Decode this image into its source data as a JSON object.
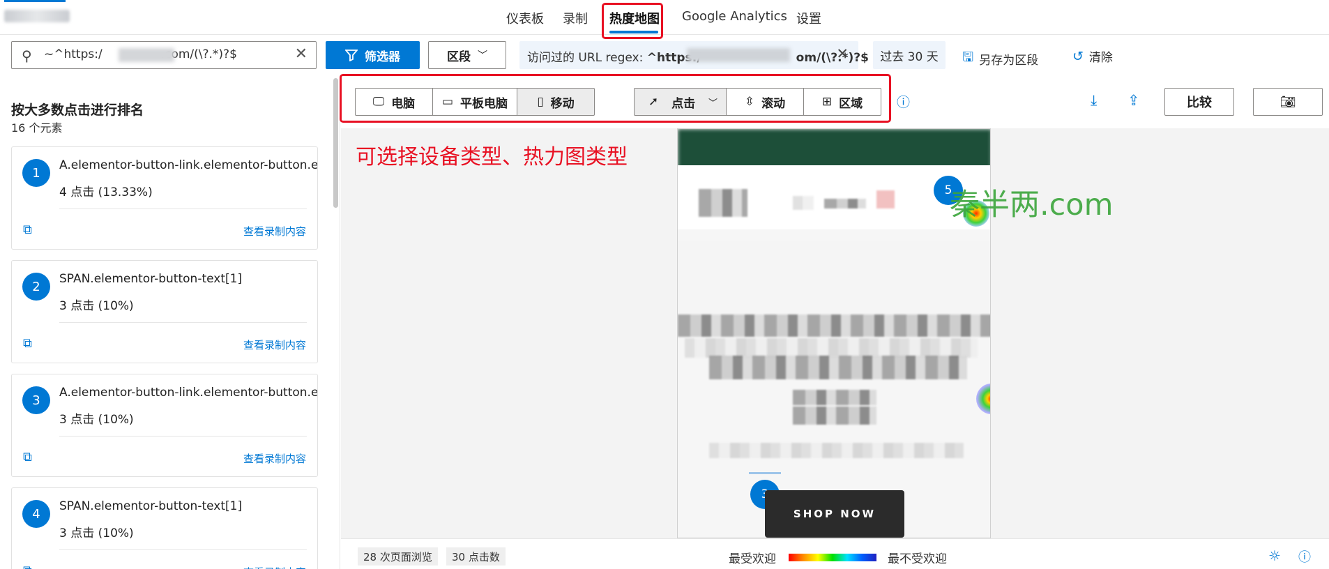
{
  "nav": {
    "tabs": [
      "仪表板",
      "录制",
      "热度地图",
      "Google Analytics",
      "设置"
    ],
    "active": "热度地图"
  },
  "filterbar": {
    "search_value": "~^https:/              .com/(\\?.*)?$",
    "search_prefix": "~^https:/",
    "search_suffix": ".com/(\\?.*)?$",
    "filter_label": "筛选器",
    "segment_label": "区段",
    "url_chip_prefix": "访问过的 URL regex: ",
    "url_chip_bold_a": "^https:/",
    "url_chip_bold_b": "om/(\\?.*)?$",
    "date_chip": "过去 30 天",
    "save_segment": "另存为区段",
    "clear": "清除"
  },
  "left_panel": {
    "title": "按大多数点击进行排名",
    "subtitle": "16 个元素",
    "view_label": "查看录制内容",
    "items": [
      {
        "rank": "1",
        "selector": "A.elementor-button-link.elementor-button.ele",
        "clicks": "4 点击 (13.33%)"
      },
      {
        "rank": "2",
        "selector": "SPAN.elementor-button-text[1]",
        "clicks": "3 点击 (10%)"
      },
      {
        "rank": "3",
        "selector": "A.elementor-button-link.elementor-button.ele",
        "clicks": "3 点击 (10%)"
      },
      {
        "rank": "4",
        "selector": "SPAN.elementor-button-text[1]",
        "clicks": "3 点击 (10%)"
      }
    ]
  },
  "toolbar": {
    "devices": [
      "电脑",
      "平板电脑",
      "移动"
    ],
    "selected_device": "移动",
    "heatmap_types": [
      "点击",
      "滚动",
      "区域"
    ],
    "compare": "比较"
  },
  "annotation": "可选择设备类型、热力图类型",
  "watermark": "秦半两.com",
  "preview": {
    "badge_top": "5",
    "badge_bottom": "3",
    "button_text": "SHOP NOW"
  },
  "bottombar": {
    "page_views": "28 次页面浏览",
    "clicks": "30 点击数",
    "legend_most": "最受欢迎",
    "legend_least": "最不受欢迎"
  },
  "colors": {
    "accent": "#0078d4",
    "annotation_red": "#e81123",
    "watermark_green": "#3aa53a",
    "url_chip_bg": "#eef4fb"
  }
}
